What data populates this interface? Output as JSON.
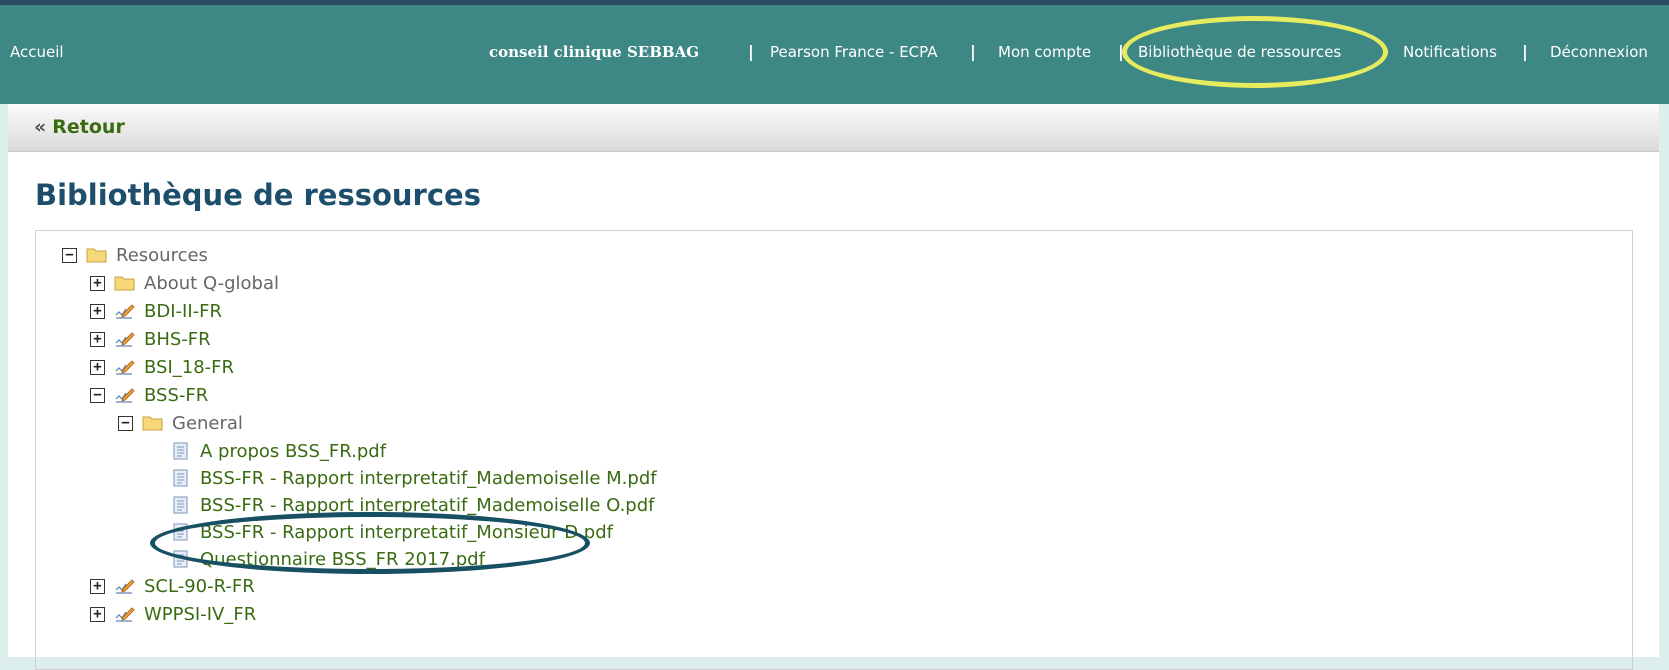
{
  "topnav": {
    "home": "Accueil",
    "user": "conseil clinique SEBBAG",
    "org": "Pearson France - ECPA",
    "account": "Mon compte",
    "library": "Bibliothèque de ressources",
    "notifications": "Notifications",
    "logout": "Déconnexion",
    "separator": "|"
  },
  "back": {
    "arrow": "«",
    "label": "Retour"
  },
  "page": {
    "title": "Bibliothèque de ressources"
  },
  "tree": {
    "root": {
      "label": "Resources",
      "toggle": "−"
    },
    "items": [
      {
        "label": "About Q-global",
        "toggle": "+"
      },
      {
        "label": "BDI-II-FR",
        "toggle": "+"
      },
      {
        "label": "BHS-FR",
        "toggle": "+"
      },
      {
        "label": "BSI_18-FR",
        "toggle": "+"
      },
      {
        "label": "BSS-FR",
        "toggle": "−"
      },
      {
        "label": "General",
        "toggle": "−"
      },
      {
        "label": "A propos BSS_FR.pdf"
      },
      {
        "label": "BSS-FR - Rapport interpretatif_Mademoiselle M.pdf"
      },
      {
        "label": "BSS-FR - Rapport interpretatif_Mademoiselle O.pdf"
      },
      {
        "label": "BSS-FR - Rapport interpretatif_Monsieur D.pdf"
      },
      {
        "label": "Questionnaire BSS_FR 2017.pdf"
      },
      {
        "label": "SCL-90-R-FR",
        "toggle": "+"
      },
      {
        "label": "WPPSI-IV_FR",
        "toggle": "+"
      }
    ]
  },
  "colors": {
    "header": "#3d8884",
    "highlight_yellow": "#e6ec5e",
    "highlight_navy": "#174f63",
    "title": "#1d4f6c",
    "link_green": "#3a6b12"
  }
}
